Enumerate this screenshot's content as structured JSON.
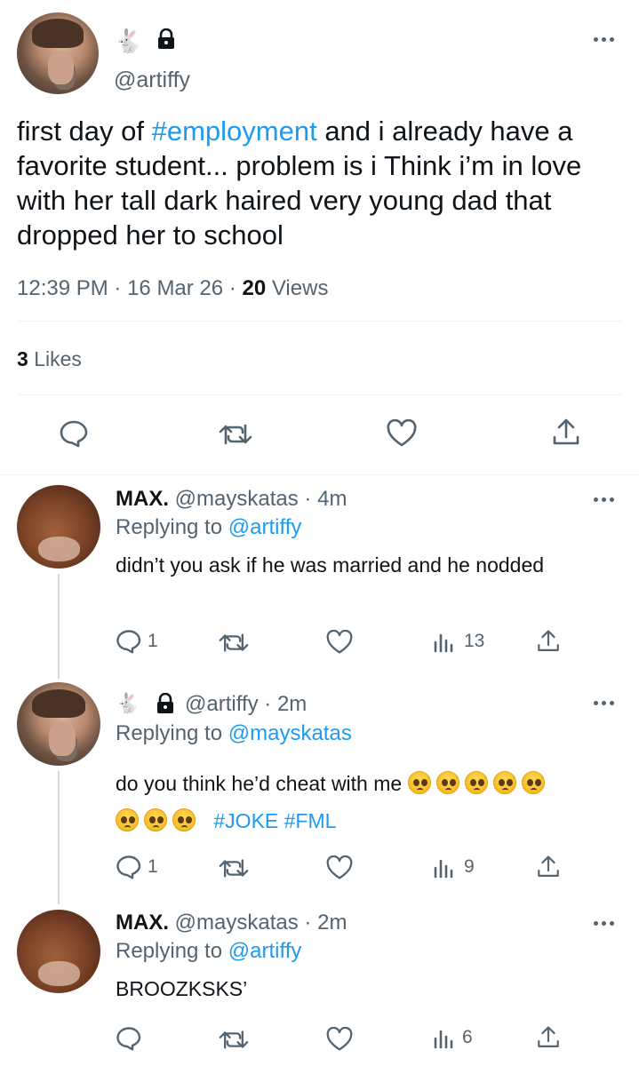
{
  "main_tweet": {
    "rabbit_glyph": "🐇",
    "handle": "@artiffy",
    "text_before": "first day of ",
    "hashtag": "#employment",
    "text_after": " and i already have a favorite student... problem is i Think i’m in love with her tall dark haired very young dad that dropped her to school",
    "time": "12:39 PM",
    "date": "16 Mar 26",
    "views_count": "20",
    "views_label": "Views",
    "likes_count": "3",
    "likes_label": "Likes"
  },
  "replies": [
    {
      "name": "MAX.",
      "handle": "@mayskatas",
      "time": "4m",
      "replying_prefix": "Replying to",
      "replying_to": "@artiffy",
      "text": "didn’t you ask if he was married and he nodded",
      "reply_count": "1",
      "views_count": "13"
    },
    {
      "rabbit_glyph": "🐇",
      "handle": "@artiffy",
      "time": "2m",
      "replying_prefix": "Replying to",
      "replying_to": "@mayskatas",
      "text": "do you think he’d cheat with me",
      "hashtags": "#JOKE #FML",
      "emoji_name": "pleading-face",
      "reply_count": "1",
      "views_count": "9"
    },
    {
      "name": "MAX.",
      "handle": "@mayskatas",
      "time": "2m",
      "replying_prefix": "Replying to",
      "replying_to": "@artiffy",
      "text": "BROOZKSKS’",
      "views_count": "6"
    }
  ],
  "separator": "·",
  "colors": {
    "link": "#1d9bf0",
    "muted": "#536471",
    "text": "#0f1419",
    "divider": "#eff3f4"
  }
}
